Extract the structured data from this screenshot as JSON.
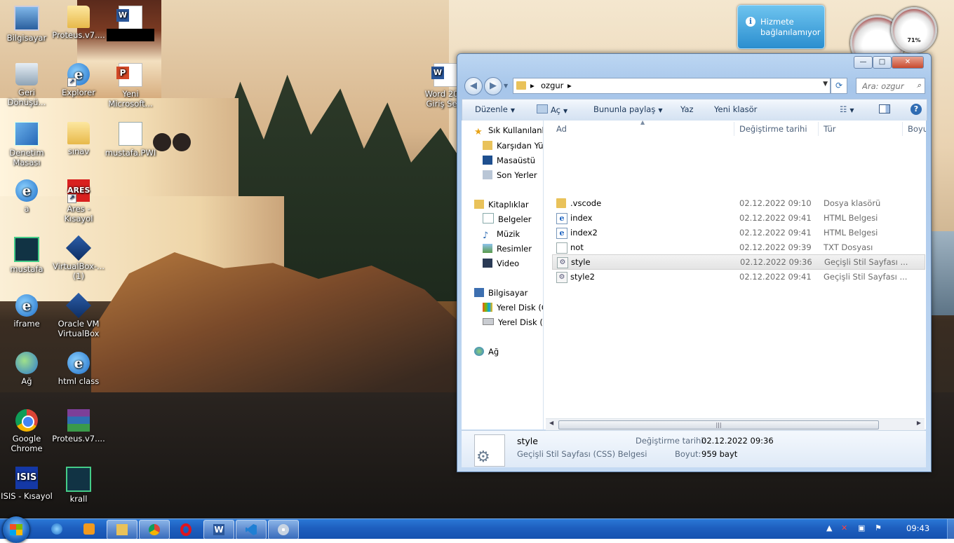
{
  "desktop": {
    "icons": [
      {
        "label": "Bilgisayar"
      },
      {
        "label": "Proteus.v7...."
      },
      {
        "label": ""
      },
      {
        "label": "Geri Dönüşü..."
      },
      {
        "label": "Explorer"
      },
      {
        "label": "Yeni Microsoft..."
      },
      {
        "label": "Word 20... Giriş Se..."
      },
      {
        "label": "Denetim Masası"
      },
      {
        "label": "sınav"
      },
      {
        "label": "mustafa.PWI"
      },
      {
        "label": "a"
      },
      {
        "label": "Ares - Kısayol"
      },
      {
        "label": "mustafa"
      },
      {
        "label": "VirtualBox-... (1)"
      },
      {
        "label": "iframe"
      },
      {
        "label": "Oracle VM VirtualBox"
      },
      {
        "label": "Ağ"
      },
      {
        "label": "html class"
      },
      {
        "label": "Google Chrome"
      },
      {
        "label": "Proteus.v7...."
      },
      {
        "label": "ISIS - Kısayol"
      },
      {
        "label": "krall"
      }
    ]
  },
  "gadgets": {
    "message_line1": "Hizmete",
    "message_line2": "bağlanılamıyor",
    "meter_value": "71%"
  },
  "explorer": {
    "window_buttons": {
      "minimize": "—",
      "maximize": "□",
      "close": "✕"
    },
    "address": {
      "crumb": "ozgur"
    },
    "search": {
      "placeholder": "Ara: ozgur"
    },
    "toolbar": {
      "organize": "Düzenle",
      "open": "Aç",
      "share": "Bununla paylaş",
      "print": "Yaz",
      "new_folder": "Yeni klasör"
    },
    "nav": {
      "favorites": "Sık Kullanılanlar",
      "fav_items": [
        "Karşıdan Yükle",
        "Masaüstü",
        "Son Yerler"
      ],
      "libraries": "Kitaplıklar",
      "lib_items": [
        "Belgeler",
        "Müzik",
        "Resimler",
        "Video"
      ],
      "computer": "Bilgisayar",
      "comp_items": [
        "Yerel Disk (C:)",
        "Yerel Disk (D:)"
      ],
      "network": "Ağ"
    },
    "columns": {
      "name": "Ad",
      "date": "Değiştirme tarihi",
      "type": "Tür",
      "size": "Boyut"
    },
    "files": [
      {
        "name": ".vscode",
        "date": "02.12.2022 09:10",
        "type": "Dosya klasörü",
        "icon": "folder-icon"
      },
      {
        "name": "index",
        "date": "02.12.2022 09:41",
        "type": "HTML Belgesi",
        "icon": "ie-html-icon"
      },
      {
        "name": "index2",
        "date": "02.12.2022 09:41",
        "type": "HTML Belgesi",
        "icon": "ie-html-icon"
      },
      {
        "name": "not",
        "date": "02.12.2022 09:39",
        "type": "TXT Dosyası",
        "icon": "text-file-icon"
      },
      {
        "name": "style",
        "date": "02.12.2022 09:36",
        "type": "Geçişli Stil Sayfası ...",
        "icon": "css-file-icon",
        "selected": true
      },
      {
        "name": "style2",
        "date": "02.12.2022 09:41",
        "type": "Geçişli Stil Sayfası ...",
        "icon": "css-file-icon"
      }
    ],
    "details": {
      "name": "style",
      "type": "Geçişli Stil Sayfası (CSS) Belgesi",
      "mod_label": "Değiştirme tarihi:",
      "mod_value": "02.12.2022 09:36",
      "size_label": "Boyut:",
      "size_value": "959 bayt"
    }
  },
  "taskbar": {
    "apps": [
      "Internet Explorer",
      "Media Player",
      "Windows Explorer",
      "Google Chrome",
      "Opera",
      "Microsoft Word",
      "Visual Studio Code",
      "Paint"
    ],
    "clock": "09:43"
  }
}
